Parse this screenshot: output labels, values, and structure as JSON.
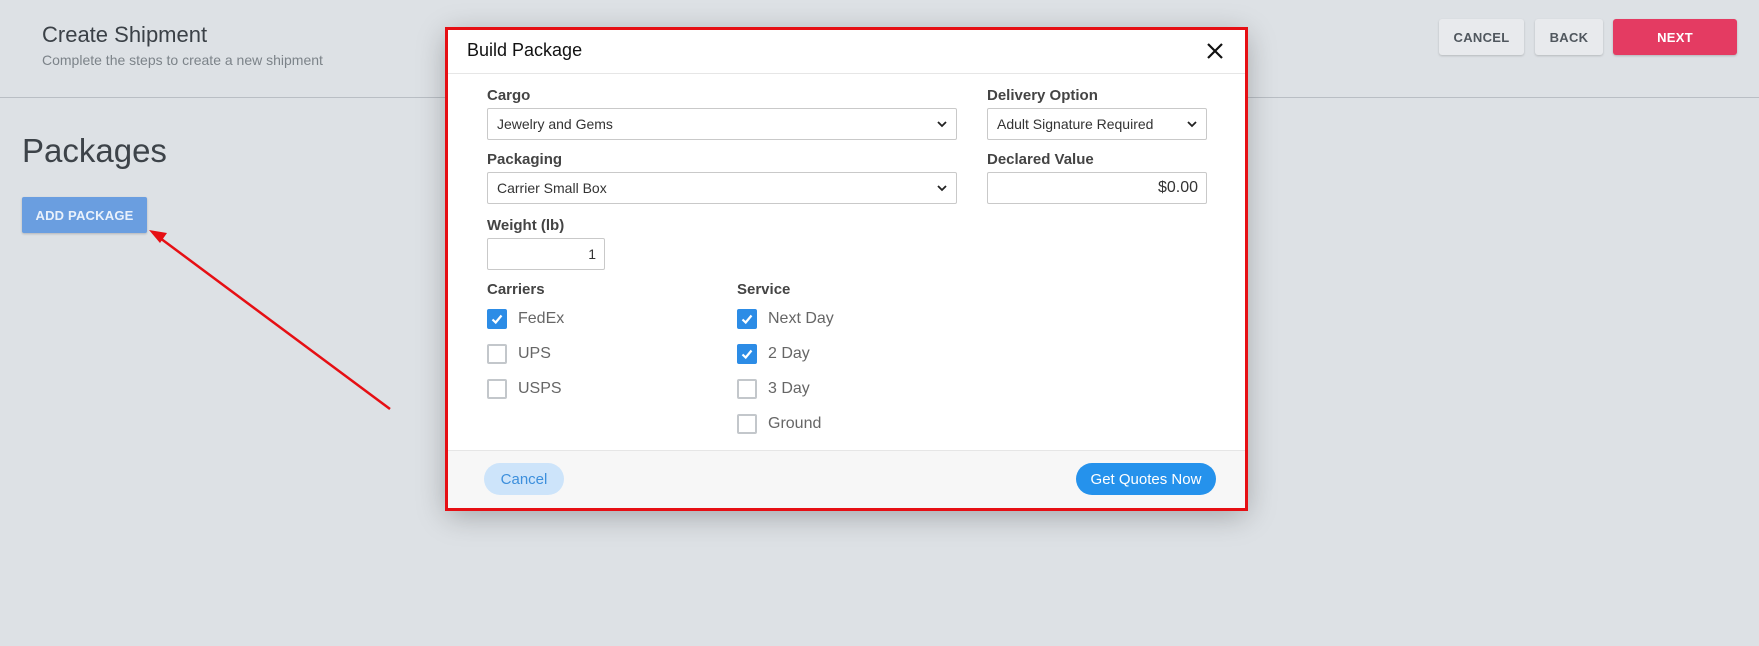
{
  "header": {
    "title": "Create Shipment",
    "subtitle": "Complete the steps to create a new shipment",
    "cancel_label": "CANCEL",
    "back_label": "BACK",
    "next_label": "NEXT"
  },
  "packages": {
    "title": "Packages",
    "add_label": "ADD PACKAGE"
  },
  "modal": {
    "title": "Build Package",
    "cargo": {
      "label": "Cargo",
      "value": "Jewelry and Gems"
    },
    "delivery_option": {
      "label": "Delivery Option",
      "value": "Adult Signature Required"
    },
    "packaging": {
      "label": "Packaging",
      "value": "Carrier Small Box"
    },
    "declared_value": {
      "label": "Declared Value",
      "value": "$0.00"
    },
    "weight": {
      "label": "Weight (lb)",
      "value": "1"
    },
    "carriers": {
      "label": "Carriers",
      "items": [
        {
          "label": "FedEx",
          "checked": true
        },
        {
          "label": "UPS",
          "checked": false
        },
        {
          "label": "USPS",
          "checked": false
        }
      ]
    },
    "service": {
      "label": "Service",
      "items": [
        {
          "label": "Next Day",
          "checked": true
        },
        {
          "label": "2 Day",
          "checked": true
        },
        {
          "label": "3 Day",
          "checked": false
        },
        {
          "label": "Ground",
          "checked": false
        }
      ]
    },
    "cancel_label": "Cancel",
    "submit_label": "Get Quotes Now"
  },
  "colors": {
    "accent": "#2592ec",
    "next_button": "#e43b62",
    "annotation": "#e60f14"
  }
}
